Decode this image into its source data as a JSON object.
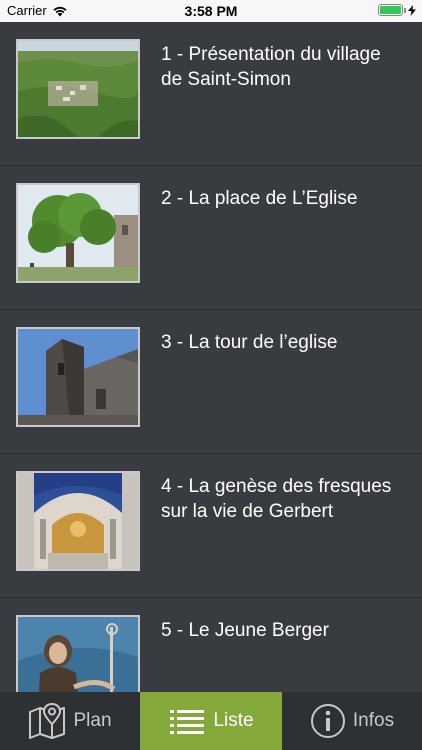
{
  "status_bar": {
    "carrier": "Carrier",
    "time": "3:58 PM",
    "icons": [
      "wifi-icon",
      "battery-icon",
      "charging-icon"
    ]
  },
  "list": {
    "items": [
      {
        "title": "1 - Présentation du village de Saint-Simon",
        "image": "village-aerial-view"
      },
      {
        "title": "2 - La place de L’Eglise",
        "image": "large-tree-square"
      },
      {
        "title": "3 - La tour de l’eglise",
        "image": "church-tower"
      },
      {
        "title": "4 - La genèse des fresques sur la vie de Gerbert",
        "image": "church-interior-frescoes"
      },
      {
        "title": "5 - Le Jeune Berger",
        "image": "young-shepherd-painting"
      }
    ]
  },
  "tabbar": {
    "tabs": [
      {
        "label": "Plan",
        "icon": "map-pin-icon",
        "active": false
      },
      {
        "label": "Liste",
        "icon": "list-icon",
        "active": true
      },
      {
        "label": "Infos",
        "icon": "info-icon",
        "active": false
      }
    ],
    "active_color": "#84a83a"
  }
}
